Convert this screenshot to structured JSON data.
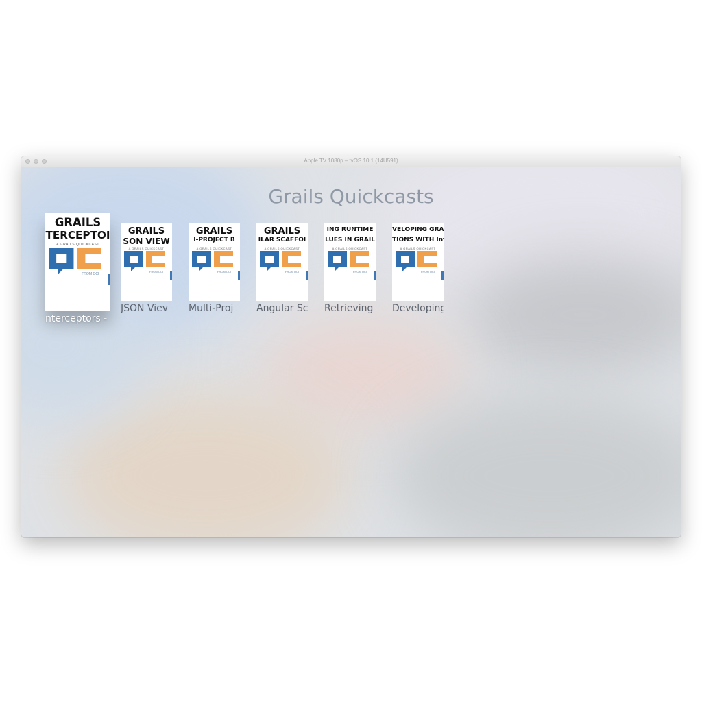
{
  "window": {
    "title": "Apple TV 1080p – tvOS 10.1 (14U591)"
  },
  "app": {
    "title": "Grails Quickcasts"
  },
  "colors": {
    "qc_blue": "#2f6fb0",
    "qc_orange": "#f0a04b"
  },
  "shelf": {
    "items": [
      {
        "poster_line1": "GRAILS",
        "poster_line2": "TERCEPTOI",
        "poster_sub": "A GRAILS QUICKCAST",
        "poster_from": "FROM OCI",
        "label": "nterceptors -"
      },
      {
        "poster_line1": "GRAILS",
        "poster_line2": "SON VIEW",
        "poster_sub": "A GRAILS QUICKCAST",
        "poster_from": "FROM OCI",
        "label": "JSON Viev"
      },
      {
        "poster_line1": "GRAILS",
        "poster_line2": "I-PROJECT B",
        "poster_sub": "A GRAILS QUICKCAST",
        "poster_from": "FROM OCI",
        "label": "Multi-Proj"
      },
      {
        "poster_line1": "GRAILS",
        "poster_line2": "ILAR SCAFFOI",
        "poster_sub": "A GRAILS QUICKCAST",
        "poster_from": "FROM OCI",
        "label": "Angular Sc"
      },
      {
        "poster_line1": "ING RUNTIME",
        "poster_line2": "LUES IN GRAIL",
        "poster_sub": "A GRAILS QUICKCAST",
        "poster_from": "FROM OCI",
        "label": "Retrieving"
      },
      {
        "poster_line1": "VELOPING GRAIL",
        "poster_line2": "TIONS WITH Inte",
        "poster_sub": "A GRAILS QUICKCAST",
        "poster_from": "FROM OCI",
        "label": "Developing"
      }
    ]
  }
}
